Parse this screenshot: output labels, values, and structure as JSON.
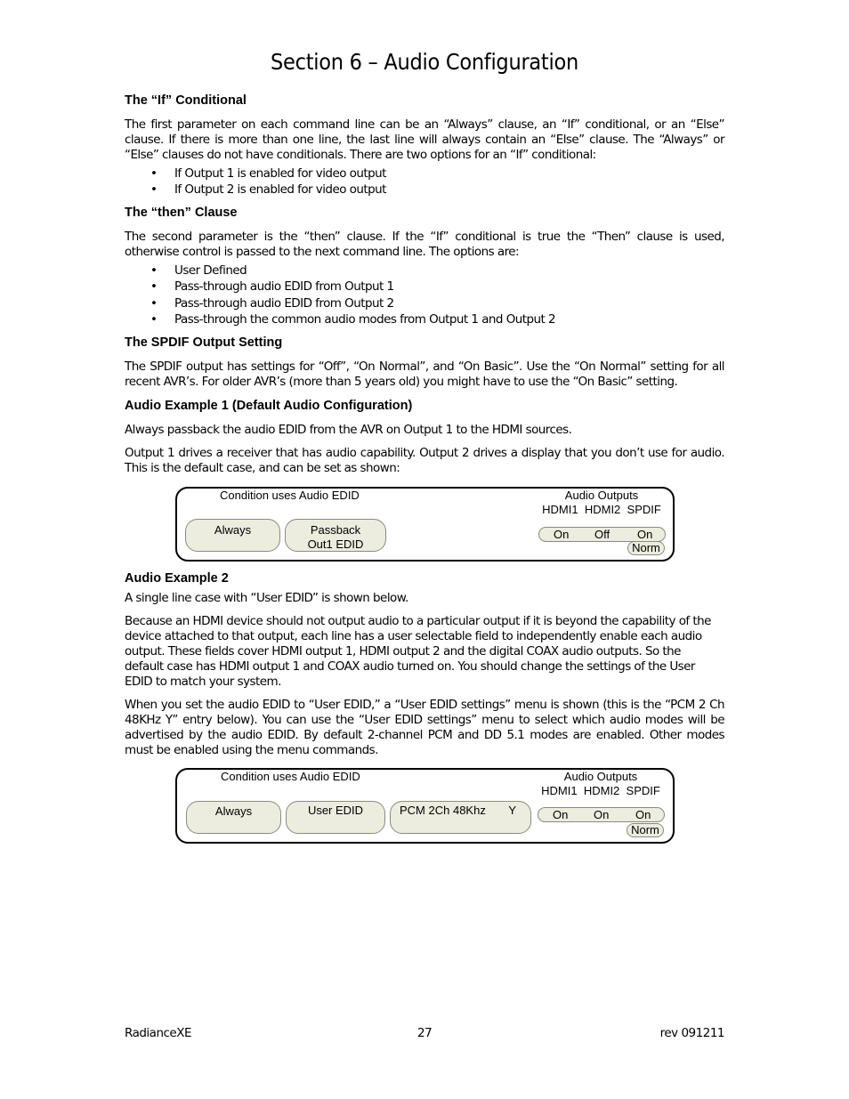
{
  "page": {
    "title": "Section 6 – Audio Configuration",
    "sections": {
      "if_conditional": {
        "heading": "The “If” Conditional",
        "paragraph": "The first parameter on each command line can be an “Always” clause, an “If” conditional, or an “Else” clause. If there is more than one line, the last line will always contain an “Else” clause. The “Always” or “Else” clauses do not have conditionals. There are two options for an “If” conditional:",
        "bullets": [
          "If Output 1 is enabled for video output",
          "If Output 2 is enabled for video output"
        ]
      },
      "then_clause": {
        "heading": "The “then” Clause",
        "paragraph": "The second parameter is the “then” clause. If the “If” conditional is true the “Then” clause is used, otherwise control is passed to the next command line. The options are:",
        "bullets": [
          "User Defined",
          "Pass-through audio EDID from Output 1",
          "Pass-through audio EDID from Output 2",
          "Pass-through the common audio modes from Output 1 and Output 2"
        ]
      },
      "spdif": {
        "heading": "The SPDIF Output Setting",
        "paragraph": "The SPDIF output has settings for “Off”, “On Normal”, and “On Basic”.  Use the “On Normal” setting for all recent AVR’s. For older AVR’s (more than 5 years old) you might have to use the “On Basic” setting."
      },
      "example1": {
        "heading": "Audio Example 1 (Default Audio Configuration)",
        "paragraph1": "Always passback the audio EDID from the AVR on Output 1 to the HDMI sources.",
        "paragraph2": "Output 1 drives a receiver that has audio capability. Output 2 drives a display that you don’t use for audio. This is the default case, and can be set as shown:",
        "diagram": {
          "condition_label": "Condition uses Audio EDID",
          "condition_value": "Always",
          "then_value_line1": "Passback",
          "then_value_line2": "Out1 EDID",
          "outputs_label": "Audio Outputs",
          "output_names": [
            "HDMI1",
            "HDMI2",
            "SPDIF"
          ],
          "output_values": [
            "On",
            "Off",
            "On"
          ],
          "spdif_mode": "Norm"
        }
      },
      "example2": {
        "heading": "Audio Example 2",
        "paragraph1": "A single line case with “User EDID” is shown below.",
        "paragraph2": "Because an HDMI device should not output audio to a particular output if it is beyond the capability of the device attached to that output, each line has a user selectable field to independently enable each audio output. These fields cover HDMI output 1, HDMI output 2 and the digital COAX audio outputs. So the default case has HDMI output 1 and COAX audio turned on. You should change the settings of the User EDID to match your system.",
        "paragraph3": "When you set the audio EDID to “User EDID,” a “User EDID settings” menu is shown (this is the “PCM 2 Ch 48KHz    Y” entry below). You can use the “User EDID settings” menu to select which audio modes will be advertised by the audio EDID. By default 2-channel PCM and DD 5.1 modes are enabled. Other modes must be enabled using the menu commands.",
        "diagram": {
          "condition_label": "Condition uses Audio EDID",
          "condition_value": "Always",
          "then_value": "User EDID",
          "mode_value": "PCM 2Ch 48Khz",
          "mode_enabled": "Y",
          "outputs_label": "Audio Outputs",
          "output_names": [
            "HDMI1",
            "HDMI2",
            "SPDIF"
          ],
          "output_values": [
            "On",
            "On",
            "On"
          ],
          "spdif_mode": "Norm"
        }
      }
    },
    "footer": {
      "left": "RadianceXE",
      "center": "27",
      "right": "rev 091211"
    },
    "bullet_glyph": "•"
  }
}
